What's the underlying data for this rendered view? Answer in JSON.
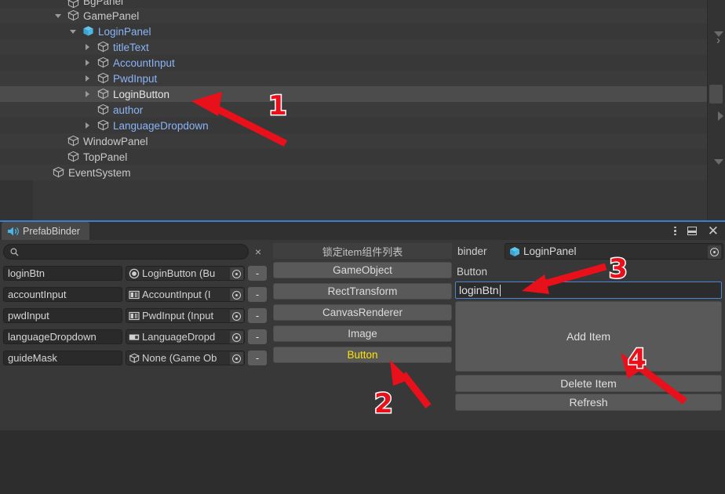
{
  "hierarchy": {
    "rows": [
      {
        "label": "BgPanel",
        "indent": 86,
        "foldout": "none",
        "color": "white",
        "selected": false,
        "partial": true
      },
      {
        "label": "GamePanel",
        "indent": 86,
        "foldout": "down",
        "color": "white",
        "selected": false
      },
      {
        "label": "LoginPanel",
        "indent": 105,
        "foldout": "down",
        "color": "blue",
        "selected": false,
        "prefab": true
      },
      {
        "label": "titleText",
        "indent": 124,
        "foldout": "right",
        "color": "blue",
        "selected": false
      },
      {
        "label": "AccountInput",
        "indent": 124,
        "foldout": "right",
        "color": "blue",
        "selected": false
      },
      {
        "label": "PwdInput",
        "indent": 124,
        "foldout": "right",
        "color": "blue",
        "selected": false
      },
      {
        "label": "LoginButton",
        "indent": 124,
        "foldout": "right",
        "color": "white",
        "selected": true
      },
      {
        "label": "author",
        "indent": 124,
        "foldout": "none",
        "color": "blue",
        "selected": false
      },
      {
        "label": "LanguageDropdown",
        "indent": 124,
        "foldout": "right",
        "color": "blue",
        "selected": false
      },
      {
        "label": "WindowPanel",
        "indent": 86,
        "foldout": "none",
        "color": "white",
        "selected": false
      },
      {
        "label": "TopPanel",
        "indent": 86,
        "foldout": "none",
        "color": "white",
        "selected": false
      },
      {
        "label": "EventSystem",
        "indent": 67,
        "foldout": "none",
        "color": "white",
        "selected": false
      }
    ]
  },
  "window": {
    "tab_label": "PrefabBinder",
    "tab_icon": "speaker-icon",
    "controls": {
      "menu": "kebab-menu-icon",
      "maximize": "maximize-icon",
      "close": "close-icon"
    }
  },
  "binder": {
    "search": {
      "value": "",
      "placeholder": "",
      "icon": "search-icon",
      "clear_label": "×"
    },
    "rows": [
      {
        "name": "loginBtn",
        "object": "LoginButton (Bu",
        "icon": "button-icon",
        "remove_label": "-"
      },
      {
        "name": "accountInput",
        "object": "AccountInput (I",
        "icon": "inputfield-icon",
        "remove_label": "-"
      },
      {
        "name": "pwdInput",
        "object": "PwdInput (Input",
        "icon": "inputfield-icon",
        "remove_label": "-"
      },
      {
        "name": "languageDropdown",
        "object": "LanguageDropd",
        "icon": "dropdown-icon",
        "remove_label": "-"
      },
      {
        "name": "guideMask",
        "object": "None (Game Ob",
        "icon": "gameobject-icon",
        "remove_label": "-"
      }
    ]
  },
  "components": {
    "title": "锁定item组件列表",
    "items": [
      {
        "label": "GameObject",
        "active": false
      },
      {
        "label": "RectTransform",
        "active": false
      },
      {
        "label": "CanvasRenderer",
        "active": false
      },
      {
        "label": "Image",
        "active": false
      },
      {
        "label": "Button",
        "active": true
      }
    ],
    "active_color": "#ffe400"
  },
  "inspector": {
    "binder_label": "binder",
    "binder_object": "LoginPanel",
    "section_label": "Button",
    "field_value": "loginBtn",
    "add_item_label": "Add Item",
    "delete_item_label": "Delete Item",
    "refresh_label": "Refresh"
  },
  "annotations": {
    "color": "#e8101b",
    "markers": [
      {
        "number": "1",
        "target": "LoginButton hierarchy row"
      },
      {
        "number": "2",
        "target": "Button component entry"
      },
      {
        "number": "3",
        "target": "binder name text input"
      },
      {
        "number": "4",
        "target": "Add Item button"
      }
    ]
  }
}
